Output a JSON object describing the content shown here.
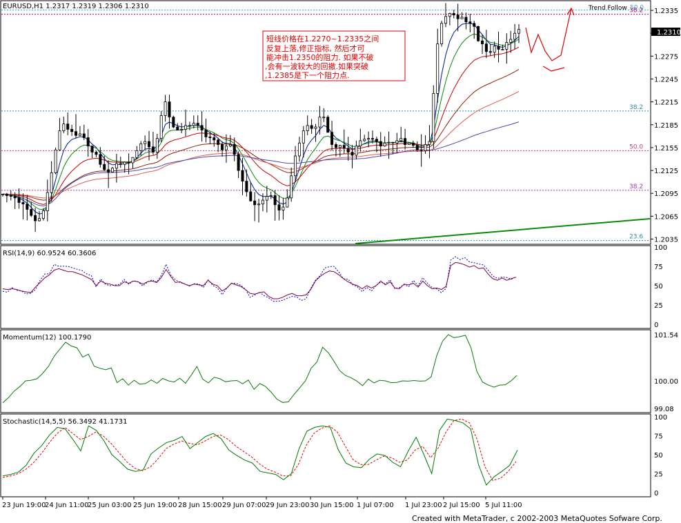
{
  "chart_data": [
    {
      "type": "candlestick",
      "panel": "price",
      "title": "EURUSD,H1  1.2317 1.2319 1.2306 1.2310",
      "last_price_label": "1.2310",
      "y_ticks": [
        "1.2335",
        "1.2305",
        "1.2275",
        "1.2245",
        "1.2215",
        "1.2185",
        "1.2155",
        "1.2125",
        "1.2095",
        "1.2065",
        "1.2035"
      ],
      "ylim": [
        1.203,
        1.2345
      ],
      "trend_label": "Trend Follow",
      "fibo_levels": [
        {
          "label": "50.0",
          "value": 1.23355,
          "color": "#3cb4c8"
        },
        {
          "label": "38.2",
          "value": 1.233,
          "color": "#b40078"
        },
        {
          "label": "38.2",
          "value": 1.2203,
          "color": "#2a8ca8"
        },
        {
          "label": "50.0",
          "value": 1.2151,
          "color": "#c83c64"
        },
        {
          "label": "38.2",
          "value": 1.2099,
          "color": "#a03ca8"
        },
        {
          "label": "23.6",
          "value": 1.2033,
          "color": "#2a8ca8"
        }
      ],
      "trendline": {
        "from": [
          79,
          1.2033
        ],
        "to": [
          146,
          1.2063
        ],
        "color": "#0a8c0a"
      },
      "annotation_text": [
        "短线价格在1.2270~1.2335之间",
        "反复上落,修正指标, 然后才可",
        "能冲击1.2350的阻力. 如果不破",
        ",会有一波较大的回撤.如果突破",
        ",1.2385是下一个阻力点."
      ],
      "annotation_color": "#e10000",
      "close": [
        1.2094,
        1.2092,
        1.2091,
        1.2089,
        1.2083,
        1.2081,
        1.2074,
        1.2066,
        1.2059,
        1.2062,
        1.2072,
        1.2096,
        1.2122,
        1.2152,
        1.2177,
        1.2186,
        1.2179,
        1.2176,
        1.2171,
        1.2173,
        1.2168,
        1.2157,
        1.2149,
        1.2146,
        1.2133,
        1.2126,
        1.2123,
        1.2128,
        1.2134,
        1.2133,
        1.2136,
        1.2135,
        1.2142,
        1.2151,
        1.216,
        1.2163,
        1.2156,
        1.2149,
        1.2167,
        1.2197,
        1.2215,
        1.2195,
        1.2182,
        1.2178,
        1.2179,
        1.2184,
        1.2184,
        1.2187,
        1.2184,
        1.2178,
        1.2169,
        1.2168,
        1.2165,
        1.2159,
        1.2152,
        1.2157,
        1.2159,
        1.2146,
        1.2125,
        1.2111,
        1.2097,
        1.2085,
        1.208,
        1.2081,
        1.2086,
        1.2091,
        1.2092,
        1.208,
        1.2073,
        1.2077,
        1.2089,
        1.2118,
        1.2144,
        1.2161,
        1.2177,
        1.2184,
        1.218,
        1.2182,
        1.2195,
        1.2195,
        1.2175,
        1.2159,
        1.2155,
        1.2158,
        1.2154,
        1.2149,
        1.2145,
        1.2157,
        1.2164,
        1.2166,
        1.2167,
        1.2166,
        1.2163,
        1.2157,
        1.2161,
        1.2162,
        1.2161,
        1.2164,
        1.2167,
        1.2159,
        1.2161,
        1.2158,
        1.2152,
        1.2151,
        1.2159,
        1.2163,
        1.2226,
        1.2291,
        1.2318,
        1.2327,
        1.2331,
        1.2329,
        1.2324,
        1.2326,
        1.232,
        1.2318,
        1.2314,
        1.2295,
        1.2291,
        1.2281,
        1.228,
        1.2288,
        1.2284,
        1.2284,
        1.2293,
        1.2297,
        1.2305,
        1.231
      ]
    },
    {
      "type": "line",
      "panel": "rsi",
      "label": "RSI(14,9)  60.9524  60.3606",
      "y_ticks": [
        "100",
        "75",
        "50",
        "25",
        "0"
      ],
      "ylim": [
        0,
        100
      ],
      "values": [
        46,
        45,
        46,
        45,
        43,
        42,
        41,
        48,
        54,
        60,
        64,
        70,
        72,
        70,
        68,
        68,
        66,
        64,
        61,
        58,
        50,
        56,
        53,
        52,
        50,
        50,
        55,
        53,
        56,
        55,
        52,
        55,
        56,
        54,
        61,
        71,
        62,
        54,
        55,
        52,
        50,
        52,
        51,
        50,
        57,
        52,
        50,
        43,
        47,
        53,
        51,
        49,
        45,
        40,
        39,
        41,
        42,
        36,
        33,
        33,
        35,
        38,
        40,
        37,
        37,
        38,
        45,
        56,
        62,
        66,
        69,
        68,
        64,
        59,
        55,
        52,
        50,
        46,
        50,
        47,
        50,
        56,
        51,
        55,
        47,
        46,
        52,
        51,
        53,
        48,
        56,
        50,
        46,
        47,
        45,
        49,
        76,
        80,
        79,
        77,
        74,
        76,
        72,
        73,
        65,
        59,
        57,
        60,
        57,
        59,
        61
      ]
    },
    {
      "type": "line",
      "panel": "momentum",
      "label": "Momentum(12)  100.1790",
      "y_ticks": [
        "101.54",
        "100.00",
        "99.08"
      ],
      "ylim": [
        99.08,
        101.54
      ],
      "values": [
        99.27,
        99.44,
        99.66,
        99.81,
        100.0,
        100.02,
        100.07,
        100.25,
        100.48,
        100.82,
        101.06,
        101.29,
        101.16,
        101.1,
        100.79,
        100.89,
        100.49,
        100.42,
        100.37,
        100.43,
        99.94,
        100.07,
        99.86,
        100.02,
        99.89,
        99.91,
        100.03,
        99.92,
        100.08,
        100.0,
        99.96,
        100.09,
        99.92,
        100.19,
        100.48,
        100.06,
        99.93,
        100.12,
        100.07,
        99.97,
        100.0,
        100.01,
        99.9,
        100.03,
        99.72,
        99.91,
        99.81,
        99.62,
        99.39,
        99.28,
        99.3,
        99.55,
        99.77,
        100.0,
        100.42,
        100.63,
        101.12,
        100.94,
        100.65,
        100.34,
        100.18,
        100.1,
        99.99,
        99.84,
        100.06,
        99.93,
        100.02,
        100.0,
        99.94,
        99.95,
        100.0,
        99.99,
        100.01,
        99.99,
        100.0,
        100.13,
        100.85,
        101.32,
        101.54,
        101.44,
        101.47,
        101.52,
        101.09,
        100.32,
        99.96,
        99.86,
        99.79,
        99.86,
        99.87,
        100.0,
        100.18
      ]
    },
    {
      "type": "line",
      "panel": "stochastic",
      "label": "Stochastic(14,5,5)  56.3492  41.1731",
      "y_ticks": [
        "100",
        "75",
        "50",
        "25",
        "0"
      ],
      "ylim": [
        0,
        100
      ],
      "main": [
        22,
        24,
        27,
        36,
        52,
        62,
        76,
        86,
        84,
        70,
        55,
        88,
        82,
        68,
        50,
        41,
        31,
        28,
        30,
        51,
        59,
        66,
        69,
        74,
        58,
        66,
        74,
        78,
        71,
        56,
        49,
        43,
        39,
        28,
        26,
        24,
        17,
        25,
        58,
        81,
        86,
        88,
        86,
        57,
        39,
        34,
        33,
        44,
        51,
        49,
        40,
        34,
        55,
        73,
        50,
        25,
        82,
        97,
        95,
        92,
        84,
        37,
        10,
        21,
        28,
        36,
        56
      ],
      "signal": [
        20,
        22,
        25,
        31,
        40,
        52,
        66,
        78,
        86,
        78,
        70,
        74,
        80,
        74,
        64,
        52,
        40,
        32,
        29,
        34,
        45,
        58,
        64,
        68,
        65,
        63,
        68,
        74,
        76,
        70,
        61,
        54,
        47,
        38,
        31,
        27,
        22,
        22,
        37,
        62,
        78,
        85,
        88,
        80,
        62,
        44,
        37,
        37,
        43,
        48,
        46,
        40,
        43,
        56,
        61,
        46,
        59,
        80,
        95,
        97,
        92,
        70,
        34,
        16,
        19,
        28,
        41
      ]
    }
  ],
  "x_labels": [
    "23 Jun 19:00",
    "24 Jun 11:00",
    "25 Jun 03:00",
    "25 Jun 19:00",
    "28 Jun 15:00",
    "29 Jun 07:00",
    "29 Jun 23:00",
    "30 Jun 15:00",
    "1 Jul 07:00",
    "1 Jul 23:00",
    "2 Jul 15:00",
    "5 Jul 11:00"
  ],
  "footer": "Created with MetaTrader, c 2002-2003 MetaQuotes Sofware Corp.",
  "colors": {
    "background": "#ffffff",
    "candles": "#000000",
    "ma_fast": "#0a2a9a",
    "ma_green": "#0a8c0a",
    "ma_red": "#c80000",
    "ma_brown": "#8b2000",
    "ma_salmon": "#e05a50",
    "ma_slate": "#4a4ab0",
    "rsi_line": "#800040",
    "rsi_signal": "#0000c8",
    "momentum": "#0a7a0a",
    "stoch_main": "#007800",
    "stoch_signal": "#e00000",
    "arrow": "#e10000"
  }
}
